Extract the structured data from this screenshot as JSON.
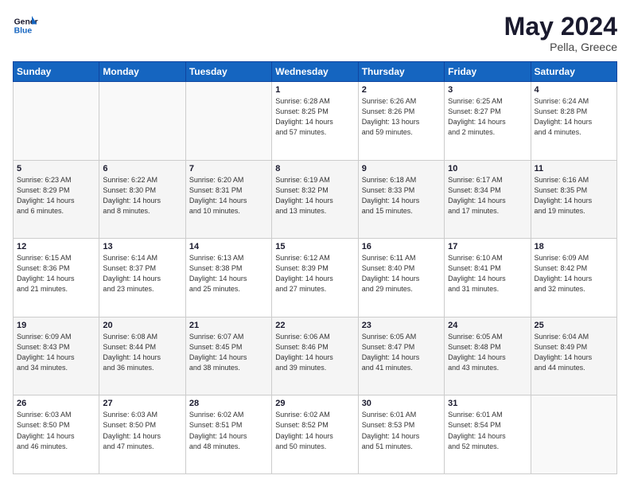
{
  "header": {
    "logo_general": "General",
    "logo_blue": "Blue",
    "month_title": "May 2024",
    "location": "Pella, Greece"
  },
  "weekdays": [
    "Sunday",
    "Monday",
    "Tuesday",
    "Wednesday",
    "Thursday",
    "Friday",
    "Saturday"
  ],
  "weeks": [
    [
      {
        "day": "",
        "info": ""
      },
      {
        "day": "",
        "info": ""
      },
      {
        "day": "",
        "info": ""
      },
      {
        "day": "1",
        "info": "Sunrise: 6:28 AM\nSunset: 8:25 PM\nDaylight: 14 hours\nand 57 minutes."
      },
      {
        "day": "2",
        "info": "Sunrise: 6:26 AM\nSunset: 8:26 PM\nDaylight: 13 hours\nand 59 minutes."
      },
      {
        "day": "3",
        "info": "Sunrise: 6:25 AM\nSunset: 8:27 PM\nDaylight: 14 hours\nand 2 minutes."
      },
      {
        "day": "4",
        "info": "Sunrise: 6:24 AM\nSunset: 8:28 PM\nDaylight: 14 hours\nand 4 minutes."
      }
    ],
    [
      {
        "day": "5",
        "info": "Sunrise: 6:23 AM\nSunset: 8:29 PM\nDaylight: 14 hours\nand 6 minutes."
      },
      {
        "day": "6",
        "info": "Sunrise: 6:22 AM\nSunset: 8:30 PM\nDaylight: 14 hours\nand 8 minutes."
      },
      {
        "day": "7",
        "info": "Sunrise: 6:20 AM\nSunset: 8:31 PM\nDaylight: 14 hours\nand 10 minutes."
      },
      {
        "day": "8",
        "info": "Sunrise: 6:19 AM\nSunset: 8:32 PM\nDaylight: 14 hours\nand 13 minutes."
      },
      {
        "day": "9",
        "info": "Sunrise: 6:18 AM\nSunset: 8:33 PM\nDaylight: 14 hours\nand 15 minutes."
      },
      {
        "day": "10",
        "info": "Sunrise: 6:17 AM\nSunset: 8:34 PM\nDaylight: 14 hours\nand 17 minutes."
      },
      {
        "day": "11",
        "info": "Sunrise: 6:16 AM\nSunset: 8:35 PM\nDaylight: 14 hours\nand 19 minutes."
      }
    ],
    [
      {
        "day": "12",
        "info": "Sunrise: 6:15 AM\nSunset: 8:36 PM\nDaylight: 14 hours\nand 21 minutes."
      },
      {
        "day": "13",
        "info": "Sunrise: 6:14 AM\nSunset: 8:37 PM\nDaylight: 14 hours\nand 23 minutes."
      },
      {
        "day": "14",
        "info": "Sunrise: 6:13 AM\nSunset: 8:38 PM\nDaylight: 14 hours\nand 25 minutes."
      },
      {
        "day": "15",
        "info": "Sunrise: 6:12 AM\nSunset: 8:39 PM\nDaylight: 14 hours\nand 27 minutes."
      },
      {
        "day": "16",
        "info": "Sunrise: 6:11 AM\nSunset: 8:40 PM\nDaylight: 14 hours\nand 29 minutes."
      },
      {
        "day": "17",
        "info": "Sunrise: 6:10 AM\nSunset: 8:41 PM\nDaylight: 14 hours\nand 31 minutes."
      },
      {
        "day": "18",
        "info": "Sunrise: 6:09 AM\nSunset: 8:42 PM\nDaylight: 14 hours\nand 32 minutes."
      }
    ],
    [
      {
        "day": "19",
        "info": "Sunrise: 6:09 AM\nSunset: 8:43 PM\nDaylight: 14 hours\nand 34 minutes."
      },
      {
        "day": "20",
        "info": "Sunrise: 6:08 AM\nSunset: 8:44 PM\nDaylight: 14 hours\nand 36 minutes."
      },
      {
        "day": "21",
        "info": "Sunrise: 6:07 AM\nSunset: 8:45 PM\nDaylight: 14 hours\nand 38 minutes."
      },
      {
        "day": "22",
        "info": "Sunrise: 6:06 AM\nSunset: 8:46 PM\nDaylight: 14 hours\nand 39 minutes."
      },
      {
        "day": "23",
        "info": "Sunrise: 6:05 AM\nSunset: 8:47 PM\nDaylight: 14 hours\nand 41 minutes."
      },
      {
        "day": "24",
        "info": "Sunrise: 6:05 AM\nSunset: 8:48 PM\nDaylight: 14 hours\nand 43 minutes."
      },
      {
        "day": "25",
        "info": "Sunrise: 6:04 AM\nSunset: 8:49 PM\nDaylight: 14 hours\nand 44 minutes."
      }
    ],
    [
      {
        "day": "26",
        "info": "Sunrise: 6:03 AM\nSunset: 8:50 PM\nDaylight: 14 hours\nand 46 minutes."
      },
      {
        "day": "27",
        "info": "Sunrise: 6:03 AM\nSunset: 8:50 PM\nDaylight: 14 hours\nand 47 minutes."
      },
      {
        "day": "28",
        "info": "Sunrise: 6:02 AM\nSunset: 8:51 PM\nDaylight: 14 hours\nand 48 minutes."
      },
      {
        "day": "29",
        "info": "Sunrise: 6:02 AM\nSunset: 8:52 PM\nDaylight: 14 hours\nand 50 minutes."
      },
      {
        "day": "30",
        "info": "Sunrise: 6:01 AM\nSunset: 8:53 PM\nDaylight: 14 hours\nand 51 minutes."
      },
      {
        "day": "31",
        "info": "Sunrise: 6:01 AM\nSunset: 8:54 PM\nDaylight: 14 hours\nand 52 minutes."
      },
      {
        "day": "",
        "info": ""
      }
    ]
  ]
}
